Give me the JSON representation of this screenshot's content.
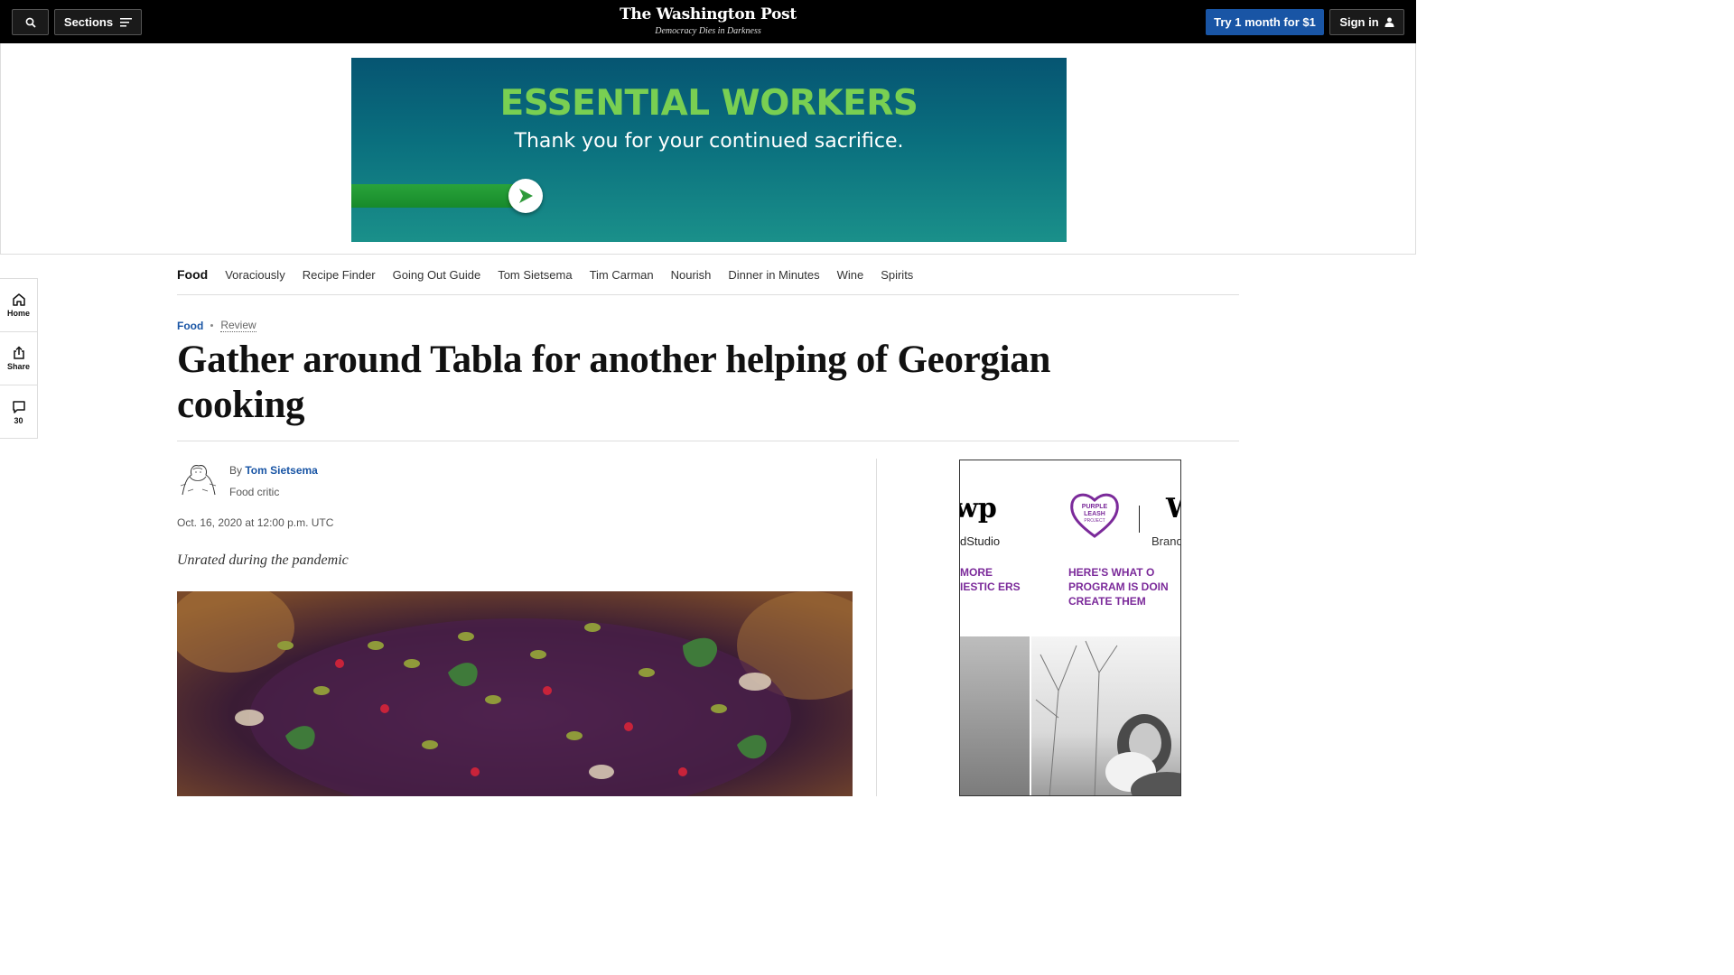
{
  "header": {
    "sections_label": "Sections",
    "brand_name": "The Washington Post",
    "brand_tagline": "Democracy Dies in Darkness",
    "try_label": "Try 1 month for $1",
    "signin_label": "Sign in"
  },
  "ad_banner": {
    "headline": "ESSENTIAL WORKERS",
    "subline": "Thank you for your continued sacrifice."
  },
  "rail": {
    "home_label": "Home",
    "share_label": "Share",
    "comments_count": "30"
  },
  "subnav": {
    "title": "Food",
    "links": [
      "Voraciously",
      "Recipe Finder",
      "Going Out Guide",
      "Tom Sietsema",
      "Tim Carman",
      "Nourish",
      "Dinner in Minutes",
      "Wine",
      "Spirits"
    ]
  },
  "article": {
    "kicker_section": "Food",
    "kicker_label": "Review",
    "headline": "Gather around Tabla for another helping of Georgian cooking",
    "byline_prefix": "By",
    "author": "Tom Sietsema",
    "author_role": "Food critic",
    "pubdate": "Oct. 16, 2020 at 12:00 p.m. UTC",
    "dek": "Unrated during the pandemic"
  },
  "side_ad": {
    "studio_text": "dStudio",
    "logo_text": "PURPLE LEASH PROJECT",
    "brand_text": "Brand",
    "text_left": "MORE IESTIC ERS",
    "text_right": "HERE'S WHAT O PROGRAM IS DOIN CREATE THEM"
  },
  "colors": {
    "accent_blue": "#1955a5",
    "ad_green": "#79cf52",
    "ad_purple": "#7b2a9a"
  }
}
